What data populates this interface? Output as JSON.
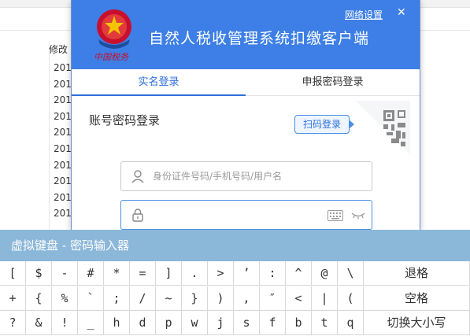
{
  "background": {
    "column_header": "修改",
    "rows": [
      "201",
      "201",
      "201",
      "201",
      "201",
      "201",
      "201",
      "201",
      "201",
      "201"
    ]
  },
  "dialog": {
    "title": "自然人税收管理系统扣缴客户端",
    "network_settings": "网络设置",
    "close_glyph": "✕",
    "colors": {
      "header": "#3d7fe6",
      "accent": "#2d6fd8"
    },
    "tabs": [
      {
        "label": "实名登录",
        "active": true
      },
      {
        "label": "申报密码登录",
        "active": false
      }
    ],
    "account_login_label": "账号密码登录",
    "scan_login_label": "扫码登录",
    "username": {
      "placeholder": "身份证件号码/手机号码/用户名",
      "value": ""
    },
    "password": {
      "placeholder": "",
      "value": ""
    }
  },
  "keyboard": {
    "title": "虚拟键盘 - 密码输入器",
    "rows": [
      [
        "[",
        "$",
        "-",
        "#",
        "*",
        "=",
        "]",
        ".",
        ">",
        "’",
        ":",
        "^",
        "@",
        "\\",
        "退格"
      ],
      [
        "+",
        "{",
        "%",
        "`",
        ";",
        "/",
        "~",
        "}",
        ")",
        ",",
        "″",
        "<",
        "|",
        "(",
        "空格"
      ],
      [
        "?",
        "&",
        "!",
        "_",
        "h",
        "d",
        "p",
        "w",
        "j",
        "s",
        "f",
        "b",
        "t",
        "q",
        "切换大小写"
      ]
    ]
  }
}
